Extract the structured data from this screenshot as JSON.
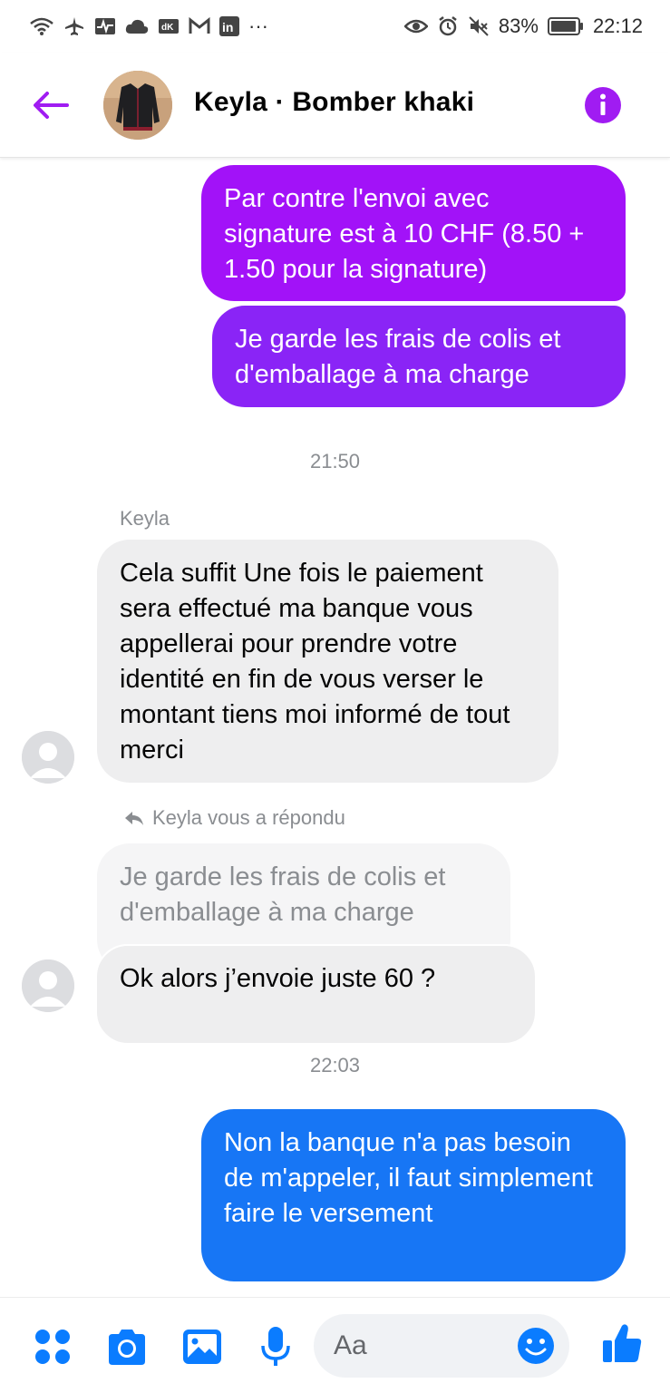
{
  "status_bar": {
    "battery": "83%",
    "time": "22:12",
    "more": "···"
  },
  "header": {
    "title": "Keyla · Bomber khaki"
  },
  "messages": {
    "out1": "Par contre l'envoi avec signature est à 10 CHF (8.50 + 1.50 pour la signature)",
    "out2": "Je garde les frais de colis et d'emballage à ma charge",
    "time1": "21:50",
    "sender": "Keyla",
    "in1": "Cela suffit Une fois le paiement sera effectué ma banque vous appellerai pour prendre votre identité en fin de vous verser le montant tiens moi informé de tout merci",
    "reply_note": "Keyla vous a répondu",
    "quoted": "Je garde les frais de colis et d'emballage à ma charge",
    "in2": "Ok alors j’envoie juste 60 ?",
    "time2": "22:03",
    "out3": "Non la banque n'a pas besoin de m'appeler, il faut simplement faire le versement"
  },
  "composer": {
    "placeholder": "Aa"
  },
  "colors": {
    "accent_purple": "#a01cf2",
    "accent_blue": "#0a7cff",
    "bubble_gradient_top": "#a012f7",
    "bubble_gradient_mid": "#7e2ff4",
    "bubble_gradient_bottom": "#1877f2",
    "incoming_bubble": "#eeeeef"
  },
  "icons": {
    "status_left": [
      "wifi-icon",
      "airplane-icon",
      "activity-icon",
      "cloud-icon",
      "vpn-icon",
      "gmail-icon",
      "linkedin-icon"
    ],
    "status_right": [
      "eye-icon",
      "alarm-icon",
      "mute-icon",
      "battery-icon"
    ],
    "composer": [
      "apps-icon",
      "camera-icon",
      "gallery-icon",
      "microphone-icon",
      "emoji-icon",
      "like-icon"
    ]
  }
}
